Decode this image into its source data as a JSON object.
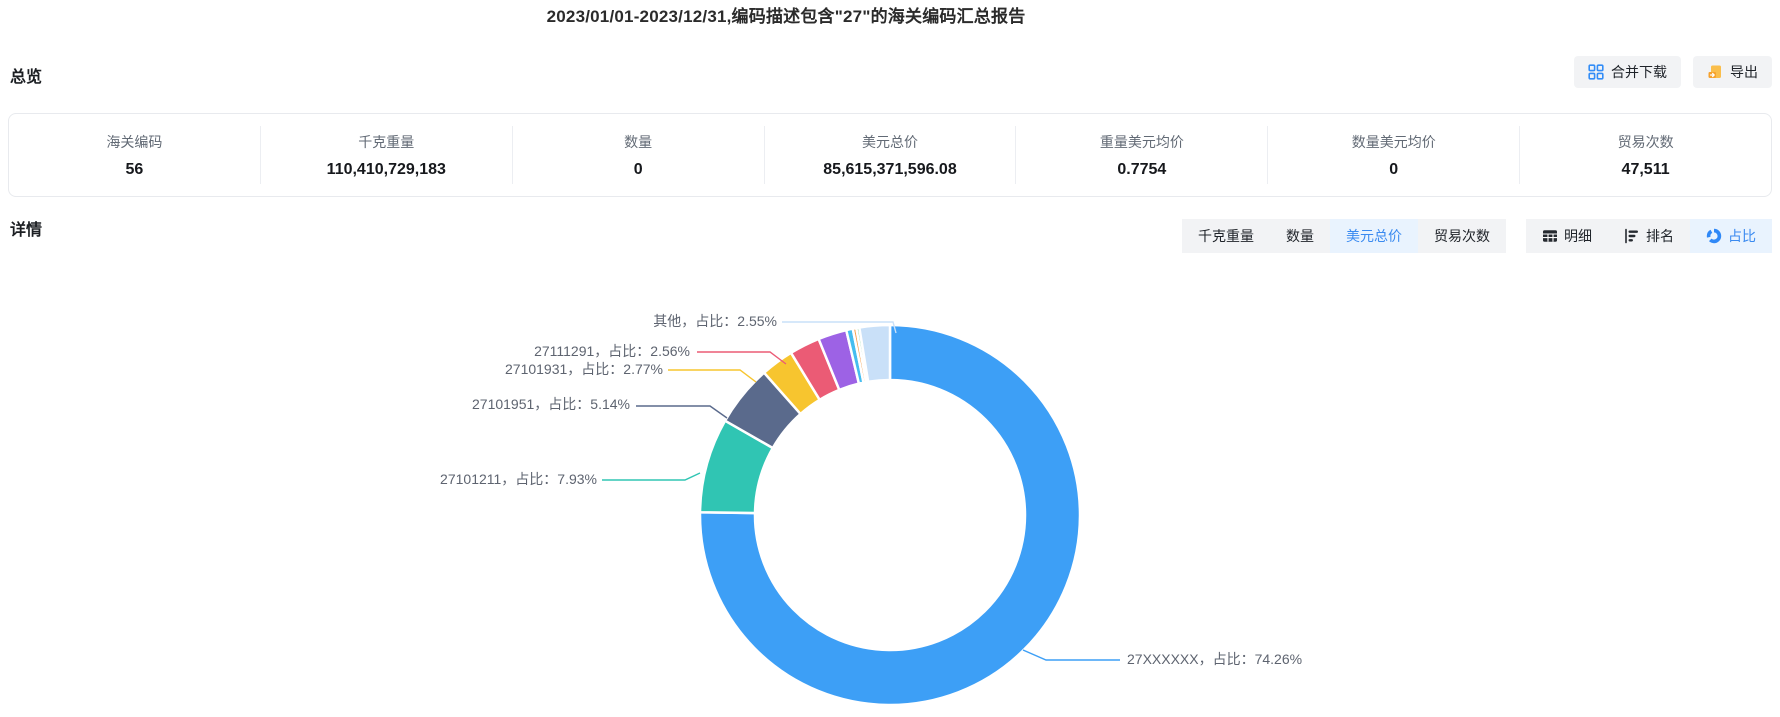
{
  "page": {
    "title": "2023/01/01-2023/12/31,编码描述包含\"27\"的海关编码汇总报告"
  },
  "overview": {
    "heading": "总览",
    "buttons": {
      "merge_download": "合并下载",
      "export": "导出"
    },
    "stats": [
      {
        "label": "海关编码",
        "value": "56"
      },
      {
        "label": "千克重量",
        "value": "110,410,729,183"
      },
      {
        "label": "数量",
        "value": "0"
      },
      {
        "label": "美元总价",
        "value": "85,615,371,596.08"
      },
      {
        "label": "重量美元均价",
        "value": "0.7754"
      },
      {
        "label": "数量美元均价",
        "value": "0"
      },
      {
        "label": "贸易次数",
        "value": "47,511"
      }
    ]
  },
  "detail": {
    "heading": "详情",
    "metric_tabs": [
      {
        "label": "千克重量",
        "active": false
      },
      {
        "label": "数量",
        "active": false
      },
      {
        "label": "美元总价",
        "active": true
      },
      {
        "label": "贸易次数",
        "active": false
      }
    ],
    "view_tabs": [
      {
        "label": "明细",
        "icon": "table-icon",
        "active": false
      },
      {
        "label": "排名",
        "icon": "ranking-icon",
        "active": false
      },
      {
        "label": "占比",
        "icon": "pie-icon",
        "active": true
      }
    ]
  },
  "colors": {
    "accent_blue": "#3a8af0",
    "active_tab_bg": "#e9f3fe",
    "inactive_tab_bg": "#f2f3f5",
    "export_icon_orange": "#f6a12d",
    "merge_icon_blue": "#338df7",
    "label_text": "#5e6470"
  },
  "chart_data": {
    "type": "pie",
    "subtype": "donut",
    "title": "",
    "legend": "none",
    "labels": "leader-line callouts, percent of 美元总价",
    "slices": [
      {
        "code": "27XXXXXX",
        "value": 74.26,
        "label": "27XXXXXX，占比：74.26%",
        "color": "#3D9FF6",
        "label_visible": true,
        "estimated": false
      },
      {
        "code": "27101211",
        "value": 7.93,
        "label": "27101211，占比：7.93%",
        "color": "#30C5B3",
        "label_visible": true,
        "estimated": false
      },
      {
        "code": "27101951",
        "value": 5.14,
        "label": "27101951，占比：5.14%",
        "color": "#5A6A8C",
        "label_visible": true,
        "estimated": false
      },
      {
        "code": "27101931",
        "value": 2.77,
        "label": "27101931，占比：2.77%",
        "color": "#F7C52F",
        "label_visible": true,
        "estimated": false
      },
      {
        "code": "27111291",
        "value": 2.56,
        "label": "27111291，占比：2.56%",
        "color": "#EB5B75",
        "label_visible": true,
        "estimated": false
      },
      {
        "code": "",
        "value": 2.4,
        "label": "",
        "color": "#9D62E5",
        "label_visible": false,
        "estimated": true
      },
      {
        "code": "",
        "value": 0.55,
        "label": "",
        "color": "#45BDEF",
        "label_visible": false,
        "estimated": true
      },
      {
        "code": "",
        "value": 0.3,
        "label": "",
        "color": "#F5A04C",
        "label_visible": false,
        "estimated": true
      },
      {
        "code": "",
        "value": 0.25,
        "label": "",
        "color": "#8ED8A0",
        "label_visible": false,
        "estimated": true
      },
      {
        "code": "其他",
        "value": 2.55,
        "label": "其他，占比：2.55%",
        "color": "#C9E0F8",
        "label_visible": true,
        "estimated": false
      }
    ]
  }
}
